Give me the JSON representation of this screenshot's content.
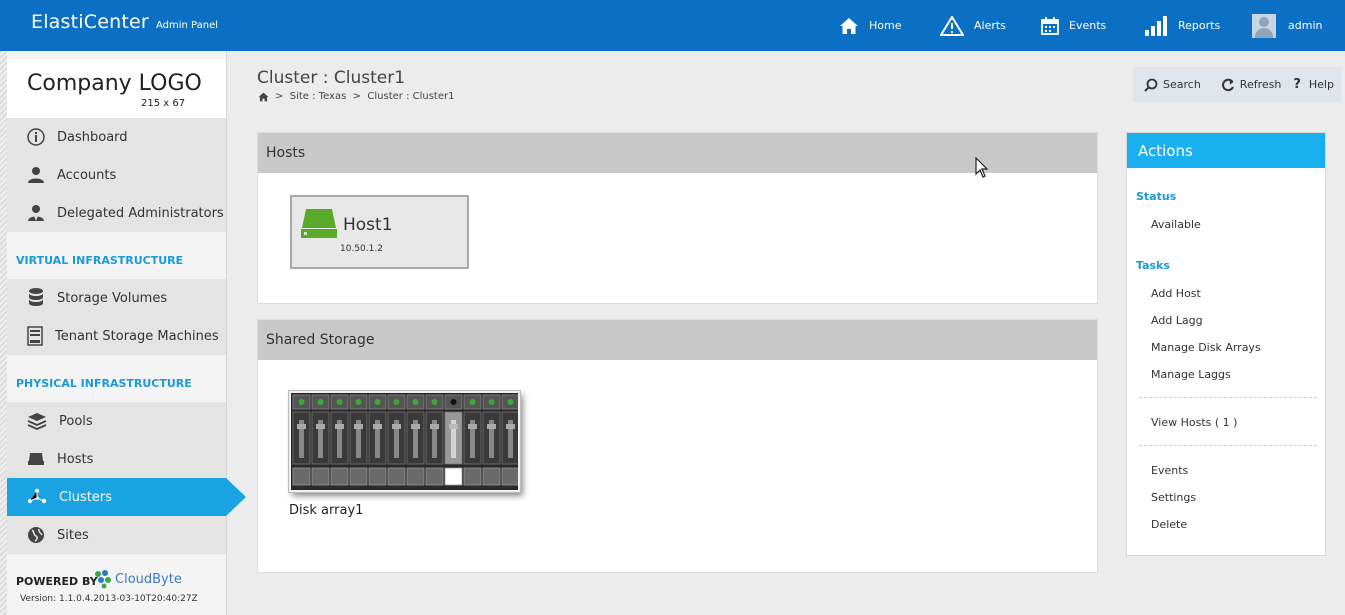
{
  "header": {
    "brand": "ElastiCenter",
    "brand_sub": "Admin Panel",
    "nav": [
      {
        "label": "Home",
        "icon": "home-icon"
      },
      {
        "label": "Alerts",
        "icon": "warning-icon"
      },
      {
        "label": "Events",
        "icon": "calendar-icon"
      },
      {
        "label": "Reports",
        "icon": "bar-chart-icon"
      },
      {
        "label": "admin",
        "icon": "user-avatar"
      }
    ]
  },
  "sidebar": {
    "logo": "Company LOGO",
    "logo_size": "215 x 67",
    "top_items": [
      {
        "label": "Dashboard",
        "icon": "info-icon"
      },
      {
        "label": "Accounts",
        "icon": "user-icon"
      },
      {
        "label": "Delegated Administrators",
        "icon": "admin-user-icon"
      }
    ],
    "virtual_header": "VIRTUAL INFRASTRUCTURE",
    "virtual_items": [
      {
        "label": "Storage Volumes",
        "icon": "database-icon"
      },
      {
        "label": "Tenant Storage Machines",
        "icon": "server-icon"
      }
    ],
    "physical_header": "PHYSICAL INFRASTRUCTURE",
    "physical_items": [
      {
        "label": "Pools",
        "icon": "layers-icon"
      },
      {
        "label": "Hosts",
        "icon": "host-icon"
      },
      {
        "label": "Clusters",
        "icon": "cluster-icon",
        "active": true
      },
      {
        "label": "Sites",
        "icon": "globe-icon"
      }
    ],
    "powered_by": "POWERED BY",
    "powered_brand": "CloudByte",
    "version": "Version: 1.1.0.4.2013-03-10T20:40:27Z"
  },
  "main": {
    "title": "Cluster : Cluster1",
    "breadcrumb": ">  Site : Texas  >  Cluster : Cluster1",
    "toolbar": {
      "search": "Search",
      "refresh": "Refresh",
      "help": "Help"
    },
    "hosts_panel": {
      "title": "Hosts",
      "hosts": [
        {
          "name": "Host1",
          "ip": "10.50.1.2"
        }
      ]
    },
    "storage_panel": {
      "title": "Shared Storage",
      "disk_array": {
        "name": "Disk array1",
        "slots": 12,
        "empty_slot_index": 8
      }
    }
  },
  "actions": {
    "title": "Actions",
    "status_header": "Status",
    "status_value": "Available",
    "tasks_header": "Tasks",
    "tasks": [
      "Add Host",
      "Add Lagg",
      "Manage Disk Arrays",
      "Manage Laggs"
    ],
    "view_hosts": "View Hosts ( 1 )",
    "more": [
      "Events",
      "Settings",
      "Delete"
    ]
  },
  "colors": {
    "topbar": "#0b6fc4",
    "accent": "#1aa3e3",
    "host_green": "#5aaa2a"
  }
}
